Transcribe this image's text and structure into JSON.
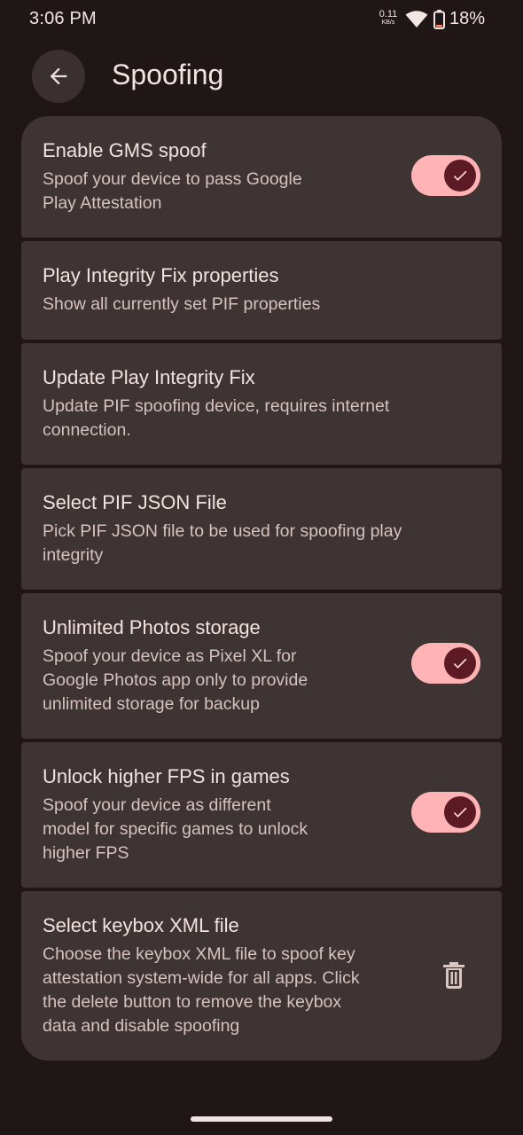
{
  "status_bar": {
    "time": "3:06 PM",
    "net_speed_value": "0.11",
    "net_speed_unit": "KB/s",
    "battery_percent": "18%"
  },
  "app_bar": {
    "title": "Spoofing",
    "back_icon": "arrow-back-icon"
  },
  "colors": {
    "background": "#1f1716",
    "card": "#3d3433",
    "switch_track_on": "#ffb3b4",
    "switch_thumb_on": "#5c1a24"
  },
  "items": [
    {
      "title": "Enable GMS spoof",
      "summary_lines": [
        "Spoof your device to pass Google",
        "Play Attestation"
      ],
      "control": "switch",
      "checked": true
    },
    {
      "title": "Play Integrity Fix properties",
      "summary_lines": [
        "Show all currently set PIF properties"
      ],
      "control": "none"
    },
    {
      "title": "Update Play Integrity Fix",
      "summary_lines": [
        "Update PIF spoofing device, requires internet",
        "connection."
      ],
      "control": "none"
    },
    {
      "title": "Select PIF JSON File",
      "summary_lines": [
        "Pick PIF JSON file to be used for spoofing play",
        "integrity"
      ],
      "control": "none"
    },
    {
      "title": "Unlimited Photos storage",
      "summary_lines": [
        "Spoof your device as Pixel XL for",
        "Google Photos app only to provide",
        "unlimited storage for backup"
      ],
      "control": "switch",
      "checked": true
    },
    {
      "title": "Unlock higher FPS in games",
      "summary_lines": [
        "Spoof your device as different",
        "model for specific games to unlock",
        "higher FPS"
      ],
      "control": "switch",
      "checked": true
    },
    {
      "title": "Select keybox XML file",
      "summary_lines": [
        "Choose the keybox XML file to spoof key",
        "attestation system-wide for all apps. Click",
        "the delete button to remove the keybox",
        "data and disable spoofing"
      ],
      "control": "delete-icon"
    }
  ]
}
